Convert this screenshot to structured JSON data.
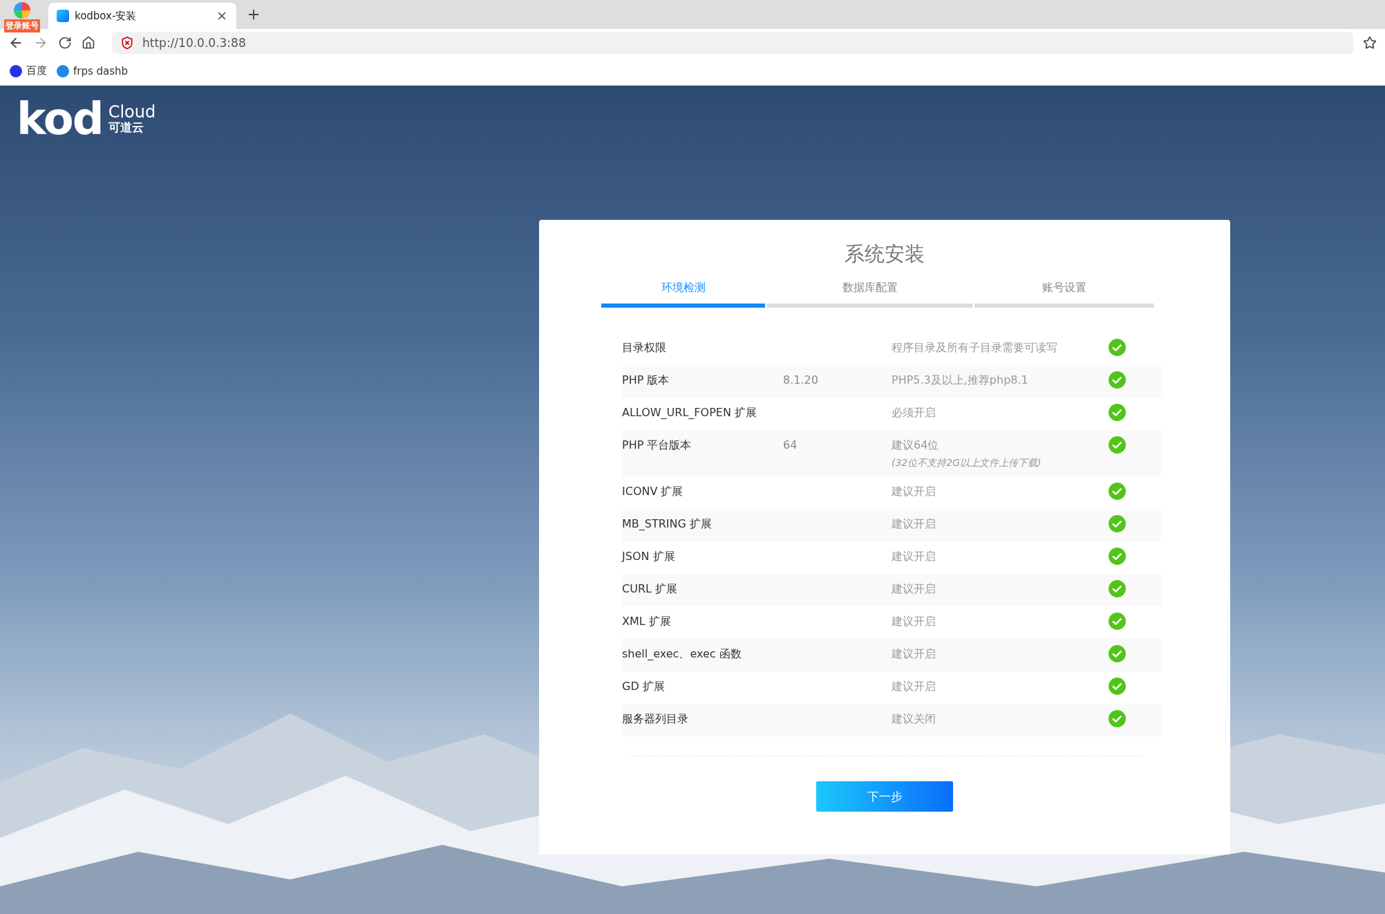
{
  "browser": {
    "profile_badge": "登录账号",
    "tabs": [
      {
        "title": "kodbox-安装",
        "selected": true
      }
    ],
    "address": "http://10.0.0.3:88",
    "bookmarks": [
      {
        "label": "百度",
        "kind": "baidu"
      },
      {
        "label": "frps dashb",
        "kind": "frps"
      }
    ]
  },
  "logo": {
    "mark": "kod",
    "word": "Cloud",
    "sub": "可道云"
  },
  "installer": {
    "title": "系统安装",
    "steps": [
      {
        "label": "环境检测",
        "selected": true
      },
      {
        "label": "数据库配置",
        "selected": false
      },
      {
        "label": "账号设置",
        "selected": false
      }
    ],
    "checks": [
      {
        "name": "目录权限",
        "requirement": "程序目录及所有子目录需要可读写",
        "passed": true
      },
      {
        "name": "PHP 版本",
        "value": "8.1.20",
        "requirement": "PHP5.3及以上,推荐php8.1",
        "passed": true
      },
      {
        "name": "ALLOW_URL_FOPEN 扩展",
        "requirement": "必须开启",
        "passed": true
      },
      {
        "name": "PHP 平台版本",
        "value": "64",
        "requirement": "建议64位",
        "note": "(32位不支持2G以上文件上传下载)",
        "passed": true
      },
      {
        "name": "ICONV 扩展",
        "requirement": "建议开启",
        "passed": true
      },
      {
        "name": "MB_STRING 扩展",
        "requirement": "建议开启",
        "passed": true
      },
      {
        "name": "JSON 扩展",
        "requirement": "建议开启",
        "passed": true
      },
      {
        "name": "CURL 扩展",
        "requirement": "建议开启",
        "passed": true
      },
      {
        "name": "XML 扩展",
        "requirement": "建议开启",
        "passed": true
      },
      {
        "name": "shell_exec、exec 函数",
        "requirement": "建议开启",
        "passed": true
      },
      {
        "name": "GD 扩展",
        "requirement": "建议开启",
        "passed": true
      },
      {
        "name": "服务器列目录",
        "requirement": "建议关闭",
        "passed": true
      }
    ],
    "next_button": "下一步"
  }
}
